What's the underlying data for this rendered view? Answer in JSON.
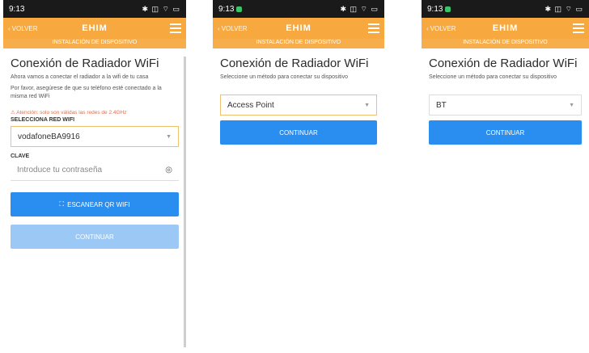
{
  "screens": [
    {
      "status_time": "9:13",
      "status_icons": "✱ ◫ ⌔ ▭",
      "back_label": "VOLVER",
      "logo": "EHIM",
      "subtitle": "INSTALACIÓN DE DISPOSITIVO",
      "title": "Conexión de Radiador WiFi",
      "desc1": "Ahora vamos a conectar el radiador a la wifi de tu casa",
      "desc2": "Por favor, asegúrese de que su teléfono esté conectado a la misma red WiFi",
      "warning": "⚠ Atención: solo son válidas las redes de 2.4GHz",
      "wifi_label": "SELECCIONA RED WIFI",
      "wifi_value": "vodafoneBA9916",
      "password_label": "CLAVE",
      "password_placeholder": "Introduce tu contraseña",
      "scan_button": "ESCANEAR QR WIFI",
      "continue_button": "CONTINUAR"
    },
    {
      "status_time": "9:13",
      "status_icons": "✱ ◫ ⌔ ▭",
      "back_label": "VOLVER",
      "logo": "EHIM",
      "subtitle": "INSTALACIÓN DE DISPOSITIVO",
      "title": "Conexión de Radiador WiFi",
      "desc1": "Seleccione un método para conectar su dispositivo",
      "method_value": "Access Point",
      "continue_button": "CONTINUAR"
    },
    {
      "status_time": "9:13",
      "status_icons": "✱ ◫ ⌔ ▭",
      "back_label": "VOLVER",
      "logo": "EHIM",
      "subtitle": "INSTALACIÓN DE DISPOSITIVO",
      "title": "Conexión de Radiador WiFi",
      "desc1": "Seleccione un método para conectar su dispositivo",
      "method_value": "BT",
      "continue_button": "CONTINUAR"
    }
  ],
  "colors": {
    "accent": "#f7a940",
    "primary_button": "#2a8ef0",
    "disabled_button": "#9cc8f6",
    "warning": "#e46c4d"
  }
}
